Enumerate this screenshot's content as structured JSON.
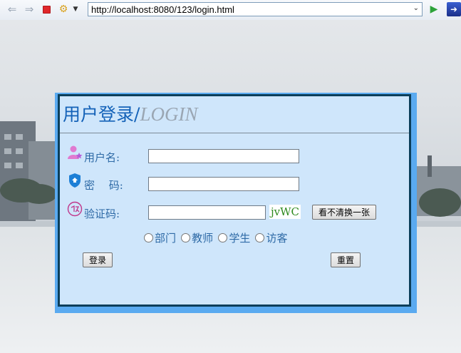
{
  "browser": {
    "url": "http://localhost:8080/123/login.html"
  },
  "login": {
    "title_cn": "用户登录",
    "title_sep": "/",
    "title_en": "LOGIN",
    "username_label": "用户名:",
    "password_label": "密　 码:",
    "captcha_label": "验证码:",
    "captcha_code": "jvWC",
    "refresh_captcha_label": "看不清换一张",
    "roles": [
      "部门",
      "教师",
      "学生",
      "访客"
    ],
    "login_button": "登录",
    "reset_button": "重置"
  },
  "icons": {
    "back": "back-arrow-icon",
    "forward": "forward-arrow-icon",
    "stop": "stop-icon",
    "tools": "tools-icon",
    "go": "go-arrow-icon",
    "user": "user-icon",
    "password": "shield-icon",
    "captcha": "captcha-stamp-icon"
  }
}
